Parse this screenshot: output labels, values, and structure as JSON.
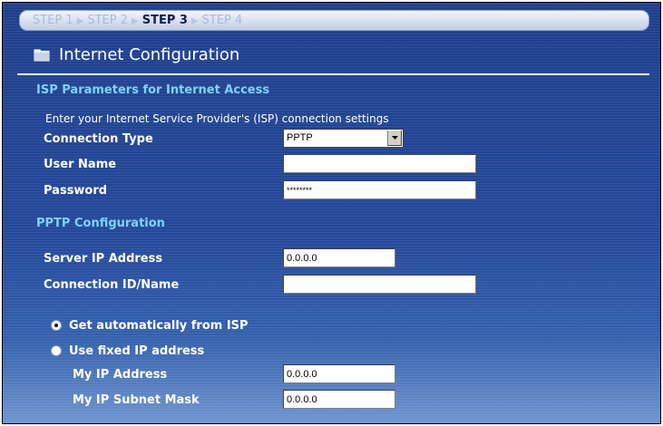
{
  "steps": [
    "STEP 1",
    "STEP 2",
    "STEP 3",
    "STEP 4"
  ],
  "active_step": "STEP 3",
  "page_title": "Internet Configuration",
  "icons": {
    "title": "folder-icon",
    "dropdown": "chevron-down-icon"
  },
  "isp": {
    "heading": "ISP Parameters for Internet Access",
    "description": "Enter your Internet Service Provider's (ISP) connection settings",
    "connection_type": {
      "label": "Connection Type",
      "value": "PPTP"
    },
    "user_name": {
      "label": "User Name",
      "value": ""
    },
    "password": {
      "label": "Password",
      "value": "********"
    }
  },
  "pptp": {
    "heading": "PPTP Configuration",
    "server_ip": {
      "label": "Server IP Address",
      "value": "0.0.0.0"
    },
    "connection_id": {
      "label": "Connection ID/Name",
      "value": ""
    },
    "ip_mode": {
      "auto_label": "Get automatically from ISP",
      "fixed_label": "Use fixed IP address",
      "selected": "auto"
    },
    "my_ip": {
      "label": "My IP Address",
      "value": "0.0.0.0"
    },
    "my_subnet": {
      "label": "My IP Subnet Mask",
      "value": "0.0.0.0"
    }
  },
  "colors": {
    "background": "#24489a",
    "section_heading": "#7dd3ff",
    "label": "#ffffff"
  }
}
